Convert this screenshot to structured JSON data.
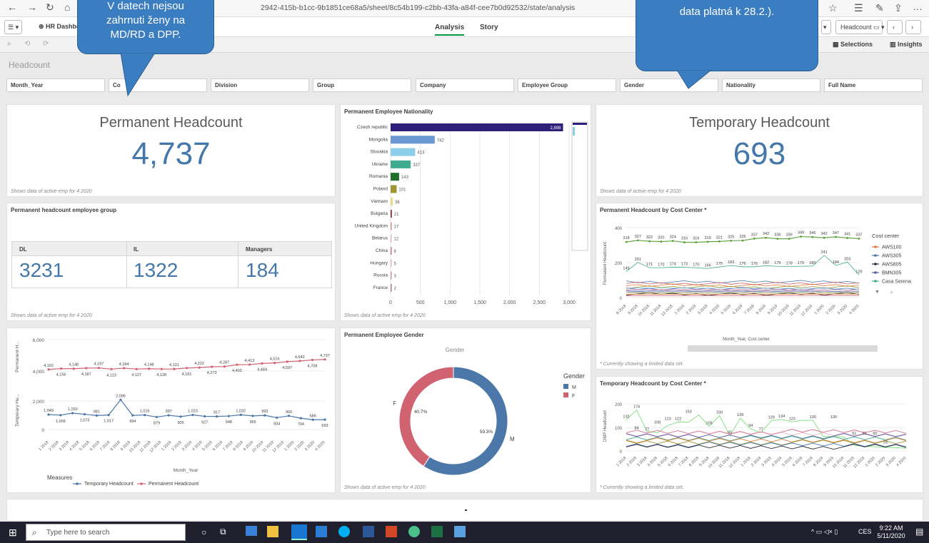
{
  "browser": {
    "url": "2942-415b-b1cc-9b1851ce68a5/sheet/8c54b199-c2bb-43fa-a84f-cee7b0d92532/state/analysis"
  },
  "toolbar": {
    "app_name": "HR Dashbo",
    "tab_analysis": "Analysis",
    "tab_story": "Story",
    "headcount_label": "Headcount",
    "selections": "Selections",
    "insights": "Insights"
  },
  "sheet": {
    "title": "Headcount"
  },
  "filters": [
    "Month_Year",
    "Co",
    "Division",
    "Group",
    "Company",
    "Employee Group",
    "Gender",
    "Nationality",
    "Full Name"
  ],
  "callouts": {
    "left": "V datech nejsou zahrnuti ženy na MD/RD a DPP.",
    "right": "data platná k 28.2.)."
  },
  "kpi_permanent": {
    "label": "Permanent Headcount",
    "value": "4,737",
    "foot": "Shows data of active emp for 4 2020"
  },
  "kpi_temporary": {
    "label": "Temporary Headcount",
    "value": "693",
    "foot": "Shows data of active emp for 4 2020"
  },
  "group_table": {
    "title": "Permanent headcount employee group",
    "headers": [
      "DL",
      "IL",
      "Managers"
    ],
    "values": [
      "3231",
      "1322",
      "184"
    ],
    "foot": "Shows data of active emp for 4 2020"
  },
  "footnotes": {
    "nationality": "Shows data of active emp for 4 2020",
    "gender": "Shows data of active emp for 4 2020",
    "cc_perm": "* Currently showing a limited data set.",
    "cc_temp": "* Currently showing a limited data set."
  },
  "taskbar": {
    "search": "Type here to search",
    "time": "9:22 AM",
    "date": "5/11/2020",
    "lang": "CES"
  },
  "chart_data": [
    {
      "type": "bar",
      "title": "Permanent Employee Nationality",
      "orientation": "horizontal",
      "categories": [
        "Czech republic",
        "Mongolia",
        "Slovakia",
        "Ukraine",
        "Romania",
        "Poland",
        "Vietnam",
        "Bulgaria",
        "United Kingdom",
        "Belarus",
        "China",
        "Hungary",
        "Russia",
        "France"
      ],
      "values": [
        2898,
        742,
        413,
        337,
        143,
        101,
        36,
        21,
        17,
        12,
        8,
        5,
        3,
        2
      ],
      "colors": [
        "#2e1f7a",
        "#6a96d1",
        "#8ccdea",
        "#3eab8f",
        "#1d6f2a",
        "#9f9631",
        "#e6d98a",
        "#8a2d2d",
        "#d98a8a",
        "#e8b5b5",
        "#d46f8c",
        "#e8b5c7",
        "#c994b3",
        "#b37a99"
      ],
      "xticks": [
        0,
        500,
        1000,
        1500,
        2000,
        2500,
        3000
      ],
      "xlim": [
        0,
        3000
      ]
    },
    {
      "type": "pie",
      "title": "Permanent Employee Gender",
      "subtitle": "Gender",
      "legend_title": "Gender",
      "slices": [
        {
          "label": "M",
          "value": 59.3,
          "color": "#4b77a9"
        },
        {
          "label": "F",
          "value": 40.7,
          "color": "#d0636f"
        }
      ],
      "value_labels": [
        "59.3%",
        "40.7%"
      ]
    },
    {
      "type": "line",
      "title": "",
      "xlabel": "Month_Year",
      "ylabel_top": "Permanent H...",
      "ylabel_bottom": "Temporary He...",
      "legend_title": "Measures",
      "x": [
        "1 2018",
        "2 2018",
        "3 2018",
        "4 2018",
        "5 2018",
        "6 2018",
        "7 2018",
        "8 2018",
        "9 2018",
        "10 2018",
        "11 2018",
        "12 2018",
        "1 2019",
        "2 2019",
        "3 2019",
        "4 2019",
        "5 2019",
        "6 2019",
        "7 2019",
        "8 2019",
        "9 2019",
        "10 2019",
        "11 2019",
        "12 2019",
        "1 2020",
        "2 2020",
        "3 2020",
        "4 2020"
      ],
      "yticks_top": [
        4000,
        6000
      ],
      "yticks_bottom": [
        0,
        2000
      ],
      "series": [
        {
          "name": "Permanent Headcount",
          "color": "#d0636f",
          "values": [
            4102,
            4156,
            4148,
            4187,
            4197,
            4123,
            4184,
            4127,
            4148,
            4128,
            4131,
            4191,
            4222,
            4273,
            4287,
            4403,
            4413,
            4484,
            4516,
            4597,
            4642,
            4708,
            4737
          ]
        },
        {
          "name": "Temporary Headcount",
          "color": "#4b77a9",
          "values": [
            1049,
            1009,
            1150,
            1073,
            981,
            1017,
            2086,
            994,
            1016,
            879,
            997,
            905,
            1023,
            927,
            917,
            948,
            1032,
            955,
            993,
            834,
            960,
            794,
            686,
            693
          ]
        }
      ],
      "labels_top": [
        "4,102",
        "4,156",
        "4,148",
        "4,187",
        "4,197",
        "4,123",
        "4,184",
        "4,127",
        "4,148",
        "4,128",
        "4,131",
        "4,191",
        "4,222",
        "4,273",
        "4,287",
        "4,403",
        "4,413",
        "4,484",
        "4,516",
        "4,597",
        "4,642",
        "4,708",
        "4,737"
      ],
      "labels_bottom": [
        "1,049",
        "1,009",
        "1,150",
        "1,073",
        "981",
        "1,017",
        "2,086",
        "994",
        "1,016",
        "879",
        "997",
        "905",
        "1,023",
        "927",
        "917",
        "948",
        "1,032",
        "955",
        "993",
        "834",
        "960",
        "794",
        "686",
        "693"
      ]
    },
    {
      "type": "line",
      "title": "Permanent Headcount by Cost Center *",
      "xlabel": "Month_Year, Cost center",
      "ylabel": "Permanent Headcount",
      "legend_title": "Cost center",
      "legend": [
        {
          "name": "AWS100",
          "color": "#e07b39"
        },
        {
          "name": "AWS305",
          "color": "#4b77a9"
        },
        {
          "name": "AWS805",
          "color": "#2a2a3a"
        },
        {
          "name": "BMN305",
          "color": "#5a5aa8"
        },
        {
          "name": "Casa Serena",
          "color": "#3eab8f"
        }
      ],
      "yticks": [
        0,
        200,
        400
      ],
      "x": [
        "8 2018",
        "9 2018",
        "10 2018",
        "11 2018",
        "12 2018",
        "1 2019",
        "2 2019",
        "3 2019",
        "4 2019",
        "5 2019",
        "6 2019",
        "7 2019",
        "8 2019",
        "9 2019",
        "10 2019",
        "11 2019",
        "12 2019",
        "1 2020",
        "2 2020",
        "3 2020",
        "4 2020"
      ],
      "top_series": {
        "values": [
          318,
          327,
          322,
          320,
          324,
          316,
          316,
          319,
          321,
          325,
          326,
          337,
          342,
          336,
          336,
          349,
          346,
          342,
          347,
          341,
          337
        ]
      },
      "second_series_labels": [
        "149",
        "201",
        "171",
        "170",
        "174",
        "173",
        "170",
        "166",
        "175",
        "183",
        "176",
        "176",
        "182",
        "179",
        "178",
        "179",
        "180",
        "241",
        "184",
        "203",
        "129"
      ]
    },
    {
      "type": "line",
      "title": "Temporary Headcount by Cost Center *",
      "ylabel": "DMP Headcount",
      "yticks": [
        0,
        100,
        200
      ],
      "x": [
        "1 2018",
        "2 2018",
        "3 2018",
        "4 2018",
        "5 2018",
        "6 2018",
        "7 2018",
        "8 2018",
        "9 2018",
        "10 2018",
        "11 2018",
        "12 2018",
        "1 2019",
        "2 2019",
        "3 2019",
        "4 2019",
        "5 2019",
        "6 2019",
        "7 2019",
        "8 2019",
        "9 2019",
        "10 2019",
        "11 2019",
        "12 2019",
        "1 2020",
        "2 2020",
        "3 2020",
        "4 2020"
      ],
      "value_labels": [
        "132",
        "174",
        "84",
        "77",
        "108",
        "123",
        "122",
        "153",
        "105",
        "150",
        "65",
        "139",
        "94",
        "77",
        "129",
        "134",
        "123",
        "130",
        "130",
        "61",
        "61",
        "60",
        "23"
      ]
    }
  ]
}
